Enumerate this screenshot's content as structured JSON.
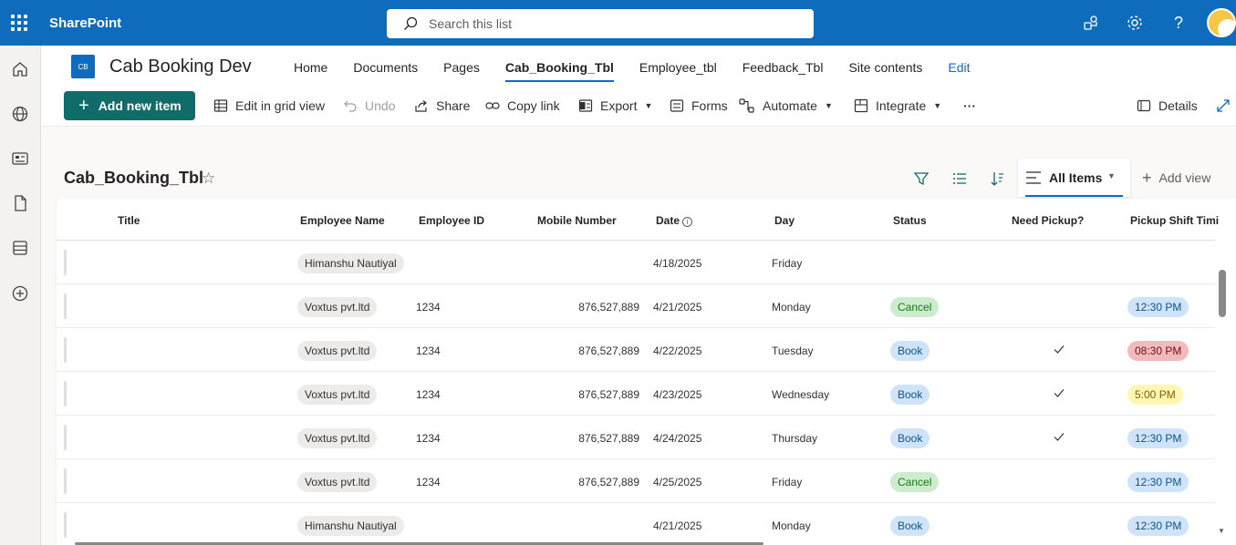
{
  "suite": {
    "app_name": "SharePoint",
    "search_placeholder": "Search this list",
    "icons": [
      "waffle-icon",
      "share-people-icon",
      "gear-icon",
      "help-icon",
      "avatar"
    ]
  },
  "left_rail": [
    "home-icon",
    "globe-icon",
    "news-icon",
    "document-icon",
    "list-icon",
    "add-circle-icon"
  ],
  "site": {
    "logo_text": "CB",
    "title": "Cab Booking Dev",
    "nav": [
      {
        "label": "Home"
      },
      {
        "label": "Documents"
      },
      {
        "label": "Pages"
      },
      {
        "label": "Cab_Booking_Tbl",
        "active": true
      },
      {
        "label": "Employee_tbl"
      },
      {
        "label": "Feedback_Tbl"
      },
      {
        "label": "Site contents"
      },
      {
        "label": "Edit"
      }
    ]
  },
  "commands": {
    "add_new_item": "Add new item",
    "edit_grid": "Edit in grid view",
    "undo": "Undo",
    "share": "Share",
    "copy_link": "Copy link",
    "export": "Export",
    "forms": "Forms",
    "automate": "Automate",
    "integrate": "Integrate",
    "more": "···",
    "details": "Details"
  },
  "list": {
    "title": "Cab_Booking_Tbl",
    "star": "☆",
    "view_name": "All Items",
    "add_view": "Add view",
    "columns": {
      "title": "Title",
      "employee_name": "Employee Name",
      "employee_id": "Employee ID",
      "mobile": "Mobile Number",
      "date": "Date",
      "day": "Day",
      "status": "Status",
      "need_pickup": "Need Pickup?",
      "shift": "Pickup Shift Timi"
    },
    "rows": [
      {
        "name": "Himanshu Nautiyal",
        "id": "",
        "mobile": "",
        "date": "4/18/2025",
        "day": "Friday",
        "status": "",
        "pickup": false,
        "shift": ""
      },
      {
        "name": "Voxtus pvt.ltd",
        "id": "1234",
        "mobile": "876,527,889",
        "date": "4/21/2025",
        "day": "Monday",
        "status": "Cancel",
        "pickup": false,
        "shift": "12:30 PM"
      },
      {
        "name": "Voxtus pvt.ltd",
        "id": "1234",
        "mobile": "876,527,889",
        "date": "4/22/2025",
        "day": "Tuesday",
        "status": "Book",
        "pickup": true,
        "shift": "08:30 PM"
      },
      {
        "name": "Voxtus pvt.ltd",
        "id": "1234",
        "mobile": "876,527,889",
        "date": "4/23/2025",
        "day": "Wednesday",
        "status": "Book",
        "pickup": true,
        "shift": "5:00 PM"
      },
      {
        "name": "Voxtus pvt.ltd",
        "id": "1234",
        "mobile": "876,527,889",
        "date": "4/24/2025",
        "day": "Thursday",
        "status": "Book",
        "pickup": true,
        "shift": "12:30 PM"
      },
      {
        "name": "Voxtus pvt.ltd",
        "id": "1234",
        "mobile": "876,527,889",
        "date": "4/25/2025",
        "day": "Friday",
        "status": "Cancel",
        "pickup": false,
        "shift": "12:30 PM"
      },
      {
        "name": "Himanshu Nautiyal",
        "id": "",
        "mobile": "",
        "date": "4/21/2025",
        "day": "Monday",
        "status": "Book",
        "pickup": false,
        "shift": "12:30 PM"
      }
    ]
  },
  "colors": {
    "suite_blue": "#0f6cbd",
    "add_button": "#106c68",
    "cancel_pill": "#cdeccd",
    "book_pill": "#cfe4fa",
    "shift_blue": "#cfe4fa",
    "shift_red": "#f1bbbc",
    "shift_yellow": "#fef7b2"
  }
}
